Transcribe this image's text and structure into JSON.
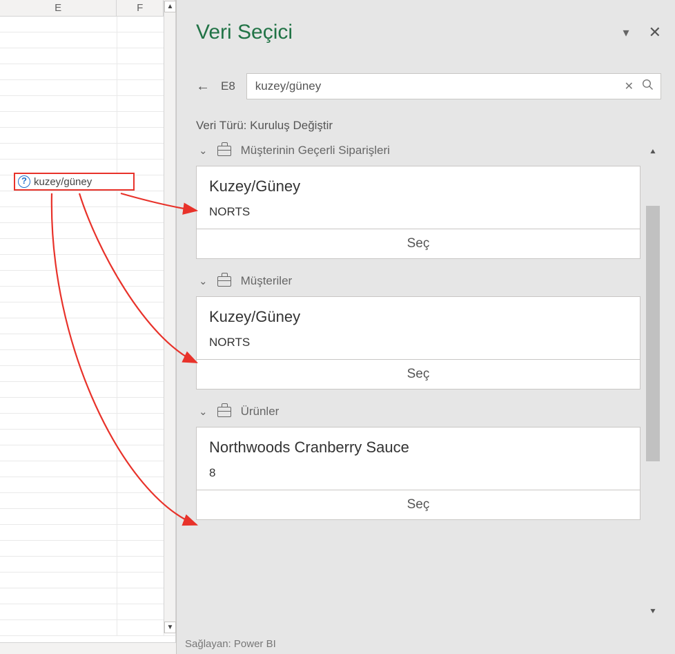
{
  "columns": {
    "e": "E",
    "f": "F"
  },
  "active_cell": {
    "text": "kuzey/güney",
    "icon_name": "question-mark-icon"
  },
  "panel": {
    "title": "Veri Seçici",
    "cell_ref": "E8",
    "search_value": "kuzey/güney",
    "data_type_line": "Veri Türü: Kuruluş Değiştir",
    "groups": [
      {
        "label": "Müşterinin Geçerli Siparişleri",
        "card": {
          "title": "Kuzey/Güney",
          "subtitle": "NORTS",
          "select": "Seç"
        }
      },
      {
        "label": "Müşteriler",
        "card": {
          "title": "Kuzey/Güney",
          "subtitle": "NORTS",
          "select": "Seç"
        }
      },
      {
        "label": "Ürünler",
        "card": {
          "title": "Northwoods Cranberry Sauce",
          "subtitle": "8",
          "select": "Seç"
        }
      }
    ],
    "footer": "Sağlayan: Power BI"
  },
  "scroll": {
    "up": "▲",
    "down": "▼"
  }
}
